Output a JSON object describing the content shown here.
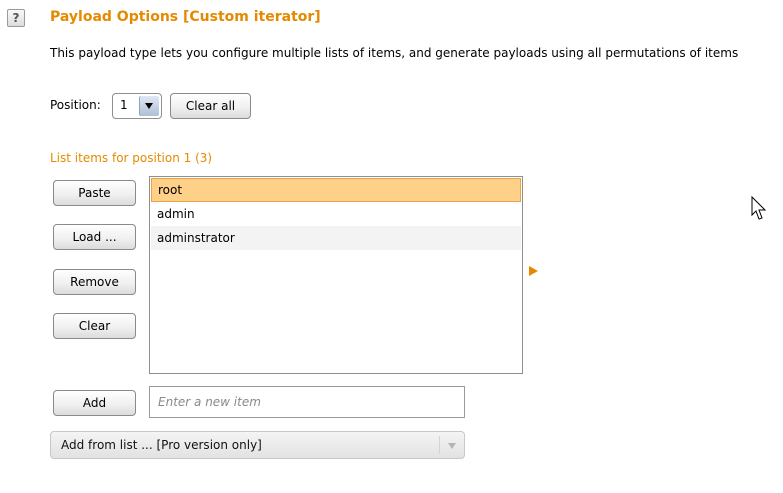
{
  "header": {
    "help_icon": "?",
    "title": "Payload Options [Custom iterator]",
    "description": "This payload type lets you configure multiple lists of items, and generate payloads using all permutations of items"
  },
  "position": {
    "label": "Position:",
    "selected": "1",
    "clear_all_label": "Clear all"
  },
  "list": {
    "header": "List items for position 1 (3)",
    "items": [
      {
        "label": "root",
        "selected": true
      },
      {
        "label": "admin",
        "selected": false
      },
      {
        "label": "adminstrator",
        "selected": false
      }
    ]
  },
  "actions": {
    "paste": "Paste",
    "load": "Load ...",
    "remove": "Remove",
    "clear": "Clear",
    "add": "Add"
  },
  "new_item": {
    "placeholder": "Enter a new item",
    "value": ""
  },
  "add_from_list": {
    "selected": "Add from list ... [Pro version only]"
  },
  "icons": {
    "help": "help-icon",
    "dropdown": "chevron-down-icon",
    "expand": "expand-right-icon",
    "cursor": "mouse-pointer-icon"
  },
  "colors": {
    "accent": "#e58a00",
    "selected_row": "#ffd088"
  }
}
